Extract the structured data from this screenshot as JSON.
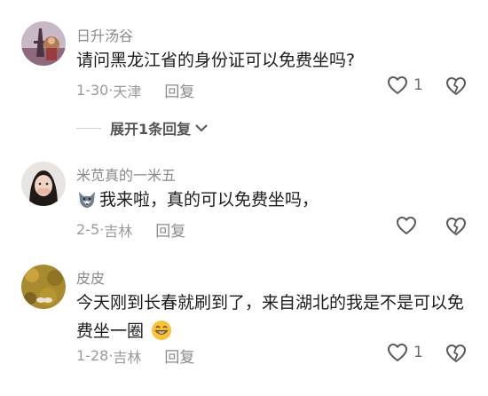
{
  "comments": [
    {
      "username": "日升汤谷",
      "text": "请问黑龙江省的身份证可以免费坐吗?",
      "date": "1-30",
      "location": "天津",
      "reply_label": "回复",
      "likes": "1"
    },
    {
      "username": "米苋真的一米五",
      "text": "我来啦，真的可以免费坐吗，",
      "date": "2-5",
      "location": "吉林",
      "reply_label": "回复",
      "likes": ""
    },
    {
      "username": "皮皮",
      "text": "今天刚到长春就刷到了，来自湖北的我是不是可以免费坐一圈",
      "date": "1-28",
      "location": "吉林",
      "reply_label": "回复",
      "likes": "1"
    }
  ],
  "expand_label": "展开1条回复",
  "icons": {
    "like": "heart-outline-icon",
    "dislike": "broken-heart-icon",
    "expand": "chevron-down-icon",
    "emoji_wolf": "wolf-emoji-icon",
    "emoji_smile": "grin-emoji-icon"
  }
}
